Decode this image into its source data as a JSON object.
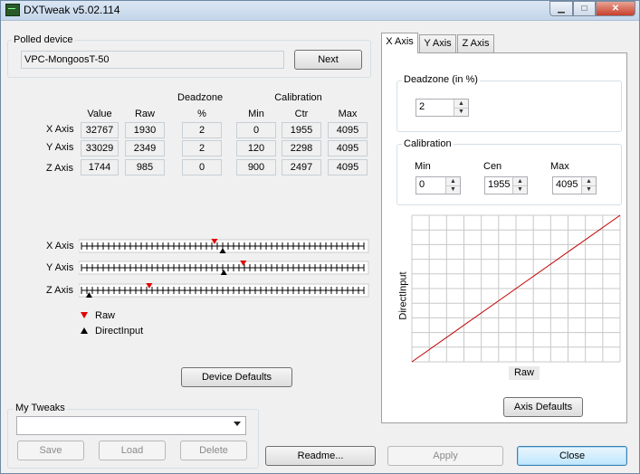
{
  "window": {
    "title": "DXTweak v5.02.114"
  },
  "polled": {
    "label": "Polled device",
    "device": "VPC-MongoosT-50",
    "next": "Next"
  },
  "table": {
    "headers": {
      "value": "Value",
      "raw": "Raw",
      "deadzone": "Deadzone",
      "deadzone_unit": "%",
      "calibration": "Calibration",
      "min": "Min",
      "ctr": "Ctr",
      "max": "Max"
    },
    "rows": [
      {
        "label": "X Axis",
        "value": "32767",
        "raw": "1930",
        "deadzone": "2",
        "min": "0",
        "ctr": "1955",
        "max": "4095"
      },
      {
        "label": "Y Axis",
        "value": "33029",
        "raw": "2349",
        "deadzone": "2",
        "min": "120",
        "ctr": "2298",
        "max": "4095"
      },
      {
        "label": "Z Axis",
        "value": "1744",
        "raw": "985",
        "deadzone": "0",
        "min": "900",
        "ctr": "2497",
        "max": "4095"
      }
    ]
  },
  "sliders": [
    {
      "label": "X Axis",
      "raw": 0.471,
      "directinput": 0.5
    },
    {
      "label": "Y Axis",
      "raw": 0.573,
      "directinput": 0.504
    },
    {
      "label": "Z Axis",
      "raw": 0.24,
      "directinput": 0.027
    }
  ],
  "legend": {
    "raw": "Raw",
    "directinput": "DirectInput",
    "raw_color": "#e00000",
    "directinput_color": "#000000"
  },
  "buttons": {
    "device_defaults": "Device Defaults",
    "readme": "Readme...",
    "apply": "Apply",
    "close": "Close",
    "axis_defaults": "Axis Defaults"
  },
  "tweaks": {
    "label": "My Tweaks",
    "selected": "",
    "save": "Save",
    "load": "Load",
    "delete": "Delete"
  },
  "tabs": [
    {
      "label": "X Axis",
      "active": true
    },
    {
      "label": "Y Axis",
      "active": false
    },
    {
      "label": "Z Axis",
      "active": false
    }
  ],
  "axis_panel": {
    "deadzone_label": "Deadzone (in %)",
    "deadzone_value": "2",
    "calibration_label": "Calibration",
    "min_label": "Min",
    "cen_label": "Cen",
    "max_label": "Max",
    "min_value": "0",
    "cen_value": "1955",
    "max_value": "4095"
  },
  "curve": {
    "xlabel": "Raw",
    "ylabel": "DirectInput",
    "line_color": "#c00000",
    "points_pct": [
      [
        0,
        0
      ],
      [
        47,
        47
      ],
      [
        49,
        49
      ],
      [
        100,
        100
      ]
    ]
  }
}
